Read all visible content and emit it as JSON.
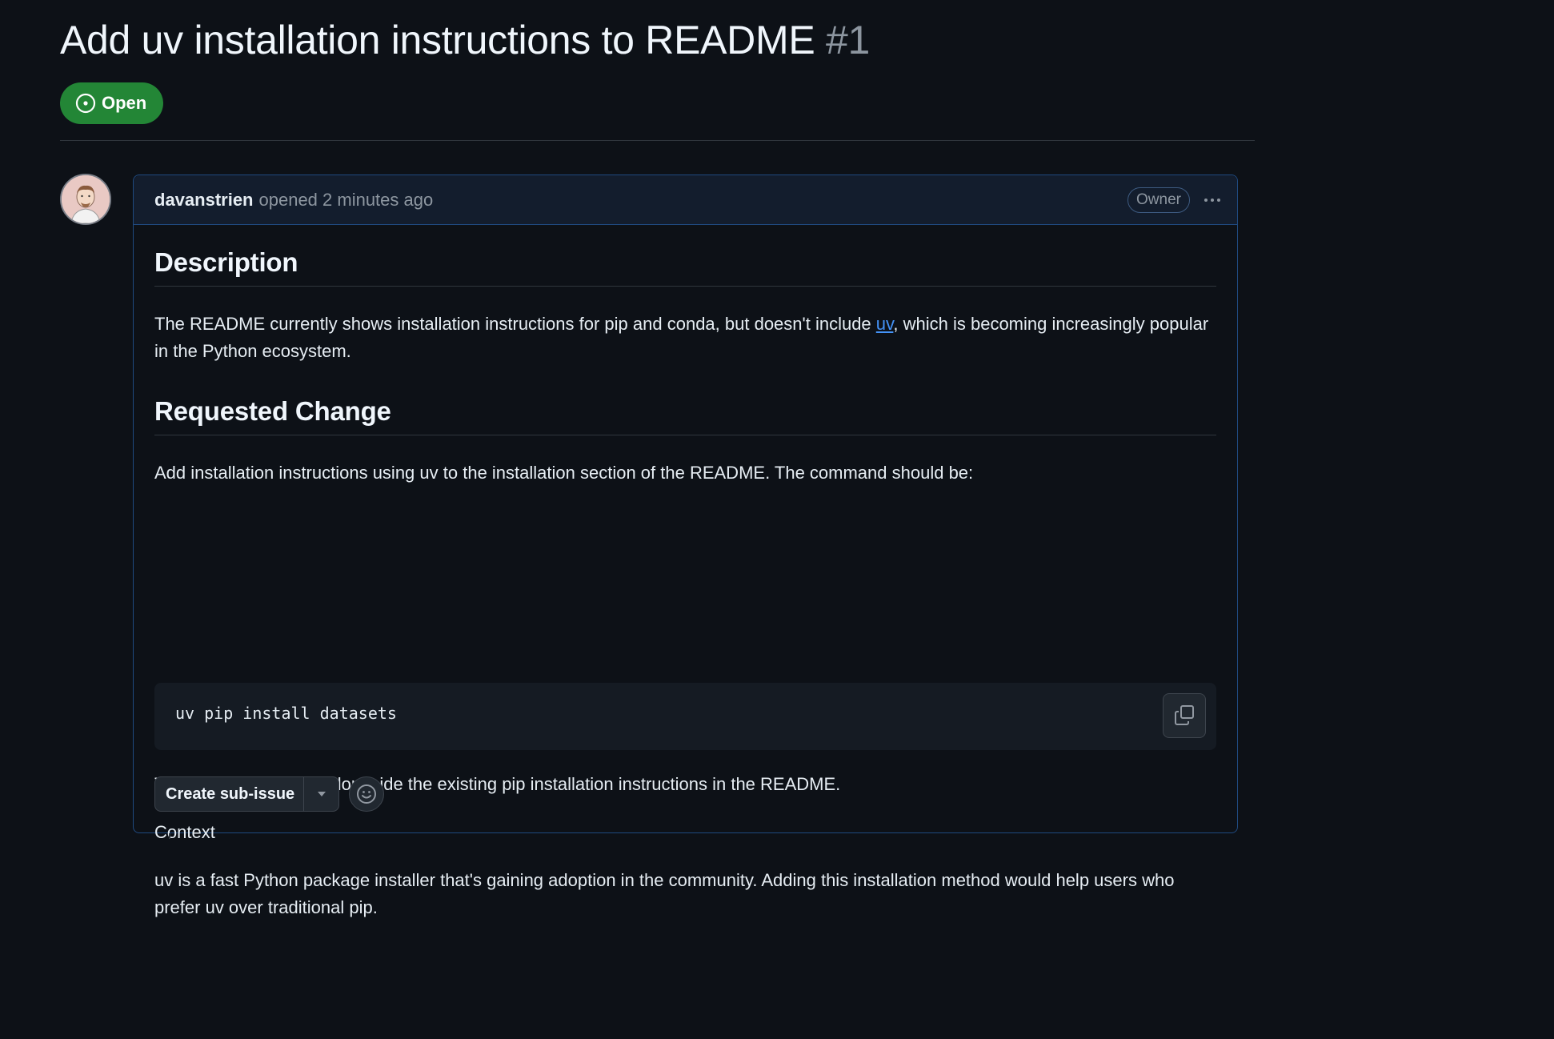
{
  "issue": {
    "title": "Add uv installation instructions to README",
    "number": "#1",
    "state": "Open",
    "state_color": "#238636"
  },
  "comment": {
    "author": "davanstrien",
    "meta": "opened 2 minutes ago",
    "role_badge": "Owner",
    "avatar_icon": "user-avatar",
    "body": {
      "heading_description": "Description",
      "para1_before": "The README currently shows installation instructions for pip and conda, but doesn't include ",
      "para1_link": "uv",
      "para1_after": ", which is becoming increasingly popular in the Python ecosystem.",
      "heading_change": "Requested Change",
      "para2": "Add installation instructions using uv to the installation section of the README. The command should be:",
      "code": "uv pip install datasets",
      "para3": "This should be added alongside the existing pip installation instructions in the README.",
      "para4": "Context",
      "para5": "uv is a fast Python package installer that's gaining adoption in the community. Adding this installation method would help users who prefer uv over traditional pip."
    }
  },
  "actions": {
    "create_sub_issue": "Create sub-issue"
  },
  "colors": {
    "background": "#0d1117",
    "link": "#4493f8",
    "header_bg": "#131d2d",
    "border_accent": "#1f4a80"
  }
}
